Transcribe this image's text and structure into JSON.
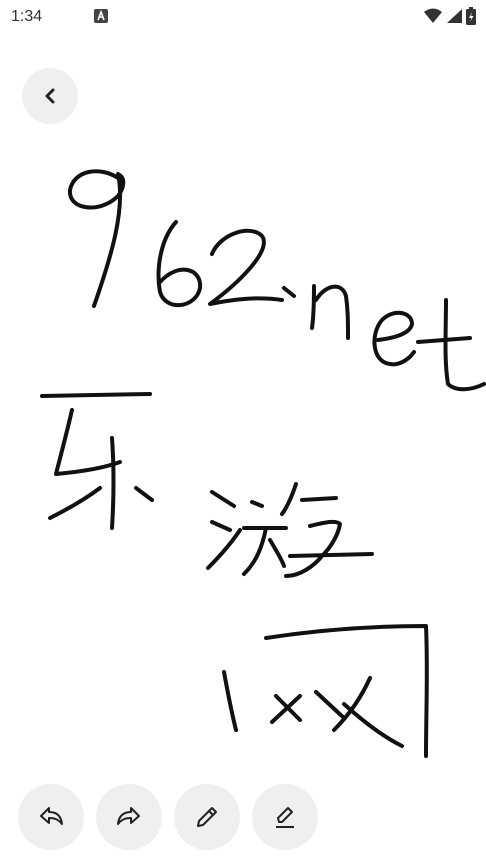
{
  "status_bar": {
    "time": "1:34",
    "notification_icon": "a-letter-icon",
    "icons": [
      "wifi-icon",
      "signal-icon",
      "battery-icon"
    ]
  },
  "toolbar": {
    "back_icon": "chevron-left-icon",
    "tools": [
      {
        "name": "undo",
        "icon": "undo-icon"
      },
      {
        "name": "redo",
        "icon": "redo-icon"
      },
      {
        "name": "pen",
        "icon": "pencil-icon"
      },
      {
        "name": "eraser",
        "icon": "eraser-icon"
      }
    ]
  },
  "colors": {
    "ink": "#111111",
    "button_bg": "#efefef"
  }
}
